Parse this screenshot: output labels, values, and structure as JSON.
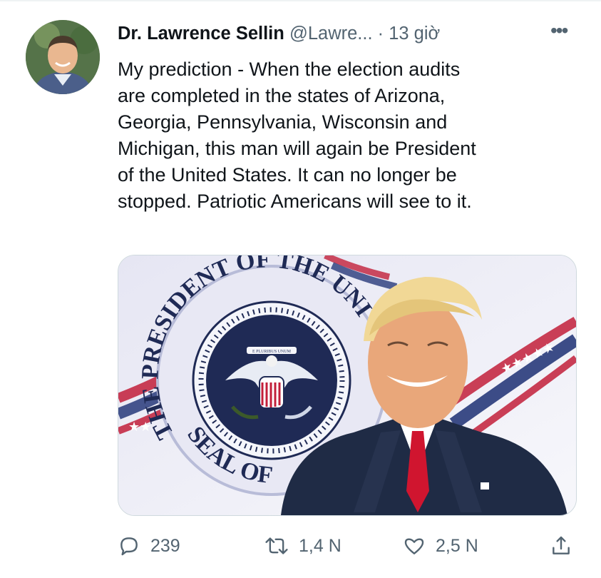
{
  "tweet": {
    "author_name": "Dr. Lawrence Sellin",
    "author_handle": "@Lawre...",
    "separator": "·",
    "time": "13 giờ",
    "more_label": "•••",
    "text": "My prediction - When the election audits\nare completed in the states of Arizona,\nGeorgia, Pennsylvania, Wisconsin and\nMichigan, this man will again be President\nof the United States. It can no longer be\nstopped. Patriotic Americans will see to it.",
    "media": {
      "seal_top_text": "THE PRESIDENT OF THE UNI",
      "seal_bottom_text": "SEAL OF",
      "seal_banner_text": "E PLURIBUS UNUM"
    }
  },
  "actions": {
    "reply_count": "239",
    "retweet_count": "1,4 N",
    "like_count": "2,5 N"
  },
  "icons": [
    "avatar",
    "more-icon",
    "reply-icon",
    "retweet-icon",
    "like-icon",
    "share-icon"
  ],
  "colors": {
    "text": "#0f1419",
    "secondary": "#536471",
    "border": "#cfd9de"
  }
}
